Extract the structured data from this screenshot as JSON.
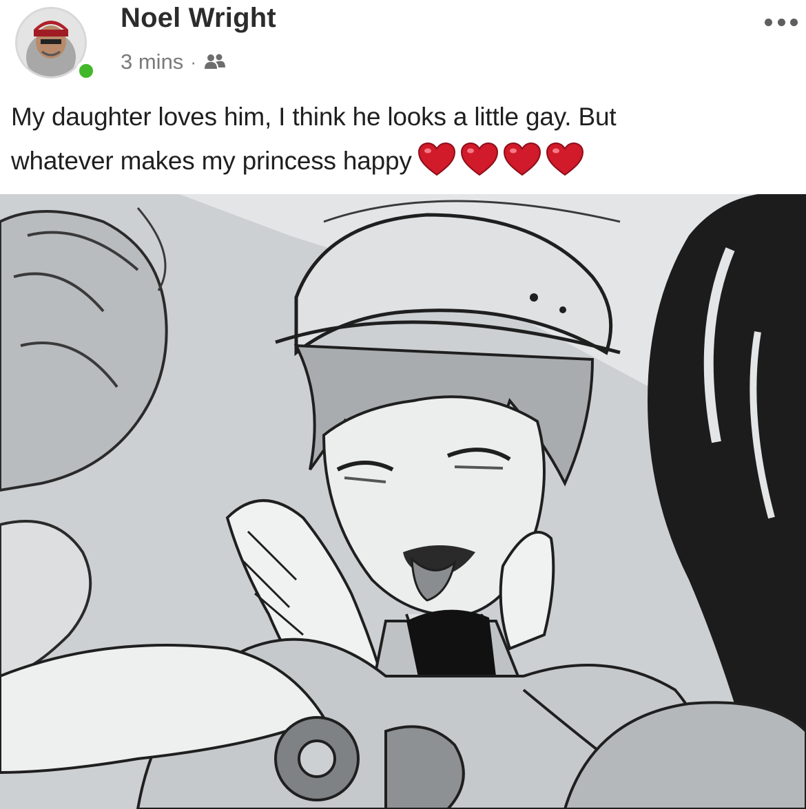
{
  "post": {
    "author": "Noel Wright",
    "timestamp": "3 mins",
    "separator": "·",
    "audience_icon": "friends-icon",
    "text_line1": "My daughter loves him, I think he looks a little gay. But",
    "text_line2": "whatever makes my princess happy",
    "hearts": [
      "red-heart",
      "red-heart",
      "red-heart",
      "red-heart"
    ],
    "status_color": "#42b72a",
    "heart_color": "#d11a2a"
  },
  "image": {
    "kind": "grayscale manga illustration",
    "tones": [
      "#cdd0d3",
      "#e8e9ea",
      "#9a9d9f",
      "#1a1a1a"
    ]
  }
}
